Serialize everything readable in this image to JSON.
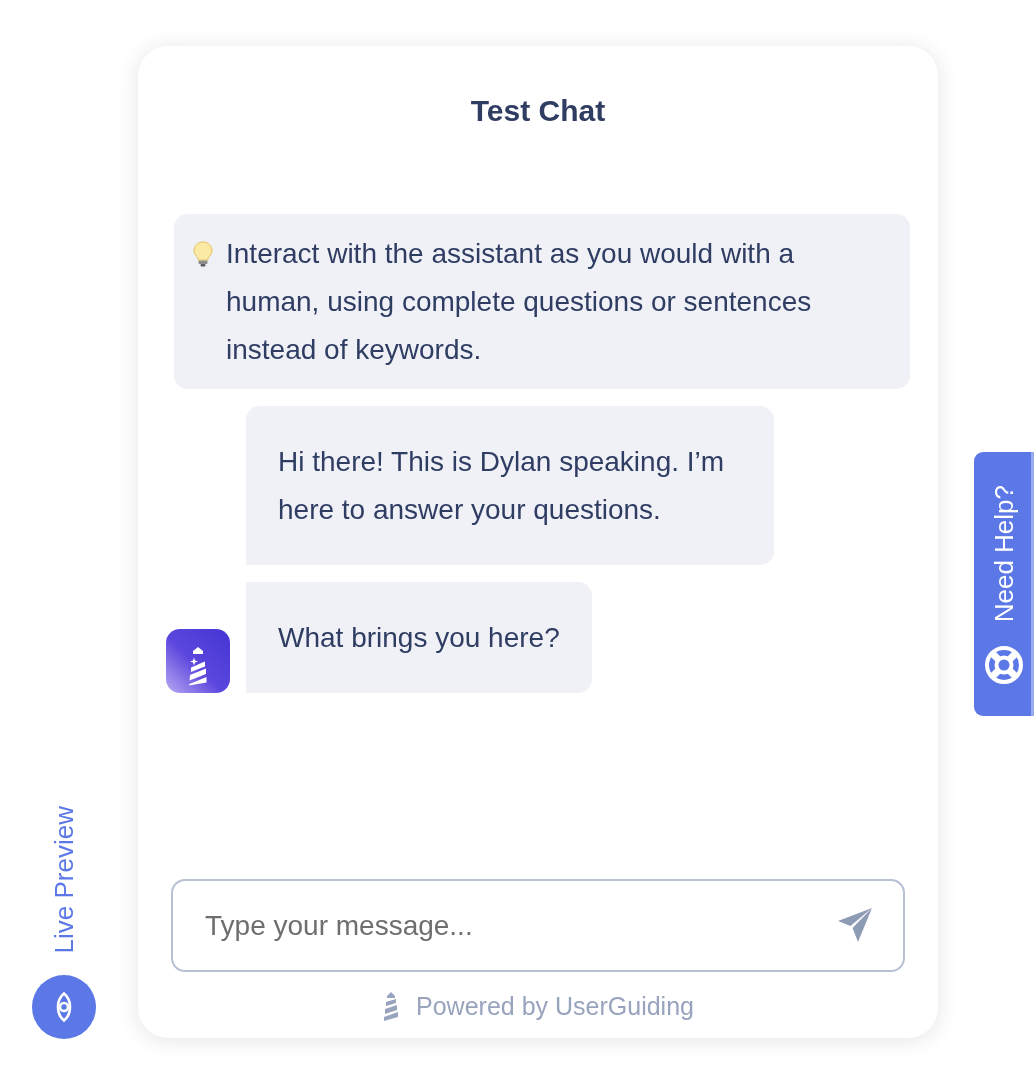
{
  "chat": {
    "title": "Test Chat",
    "messages": [
      {
        "kind": "tip",
        "text": "Interact with the assistant as you would with a human, using complete questions or sentences instead of keywords."
      },
      {
        "kind": "bot",
        "text": "Hi there! This is Dylan speaking. I’m here to answer your questions."
      },
      {
        "kind": "bot",
        "text": "What brings you here?"
      }
    ],
    "composer": {
      "placeholder": "Type your message..."
    },
    "footer": {
      "text": "Powered by UserGuiding"
    }
  },
  "live_preview": {
    "label": "Live Preview"
  },
  "help_tab": {
    "label": "Need Help?"
  }
}
